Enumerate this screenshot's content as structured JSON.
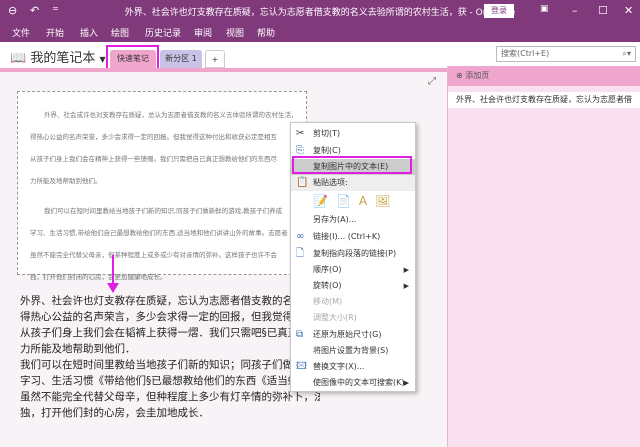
{
  "window": {
    "title": "外界、社会许也灯支教存在质疑，忘认为志愿者借支教的名义去验所谓的农村生活，获 - OneNote",
    "login": "登录"
  },
  "menu": [
    "文件",
    "开始",
    "插入",
    "绘图",
    "历史记录",
    "审阅",
    "视图",
    "帮助"
  ],
  "notebook": {
    "name": "我的笔记本",
    "tabs": [
      "快速笔记",
      "新分区 1",
      "+"
    ],
    "search_placeholder": "搜索(Ctrl+E)"
  },
  "pages": {
    "add": "添加页",
    "items": [
      "外界、社会许也灯支教存在质疑，忘认为志愿者借"
    ]
  },
  "image_text": [
    "外界、社会或许也对支教存在质疑，总认为志愿者借支教的名义去体验所谓的农村生活，获",
    "得热心公益的名声荣誉，多少会求得一定的回报。但我觉得这种付出和收获必定是相互",
    "从孩子们身上我们会在精神上获得一些馈赠。我们只需把自己真正想教给他们的东西尽",
    "力所能及地帮助到他们。",
    "我们可以在短时间里教给当地孩子们新的知识,同孩子们做新鲜的游戏,教孩子们养成",
    "学习、生活习惯,带给他们自己最想教给他们的东西,适当地和他们讲讲山外的故事。志愿者",
    "虽然不能完全代替父母亲，但某种程度上或多或少有对亲情的弥补。这样孩子也许不会",
    "独，打开他们封闭的心房，会更加健康地成长。"
  ],
  "body_text": [
    "外界、社会许也灯支教存在质疑，忘认为志愿者借支教的名义去验",
    "得热心公益的名声荣言，多少会求得一定的回报，但我觉得泫种何",
    "从孩子们身上我们会在韬裤上获得一熠．我们只需吧§已真正想教",
    "力所能及地帮助到他们．",
    "我们可以在短时间里教给当地孩子们新的知识；同孩子们做新的游",
    "字习、生活习惯《带给他们§已最想教给他们的东西《适当蝎他们",
    "虽然不能完全代替父母辛，但种程度上多少有灯辛情的弥补卜，泫",
    "独，打开他们封的心房，会圭加地成长．"
  ],
  "context_menu": {
    "cut": "剪切(T)",
    "copy": "复制(C)",
    "copy_text": "复制图片中的文本(E)",
    "paste_options": "粘贴选项:",
    "save_as": "另存为(A)...",
    "link": "链接(I)...  (Ctrl+K)",
    "copy_link": "复制指向段落的链接(P)",
    "order": "顺序(O)",
    "rotate": "旋转(O)",
    "move": "移动(M)",
    "resize": "调整大小(R)",
    "restore": "还原为原始尺寸(G)",
    "set_bg": "将图片设置为背景(S)",
    "alt_text": "替换文字(X)...",
    "searchable": "使图像中的文本可搜索(K)"
  }
}
